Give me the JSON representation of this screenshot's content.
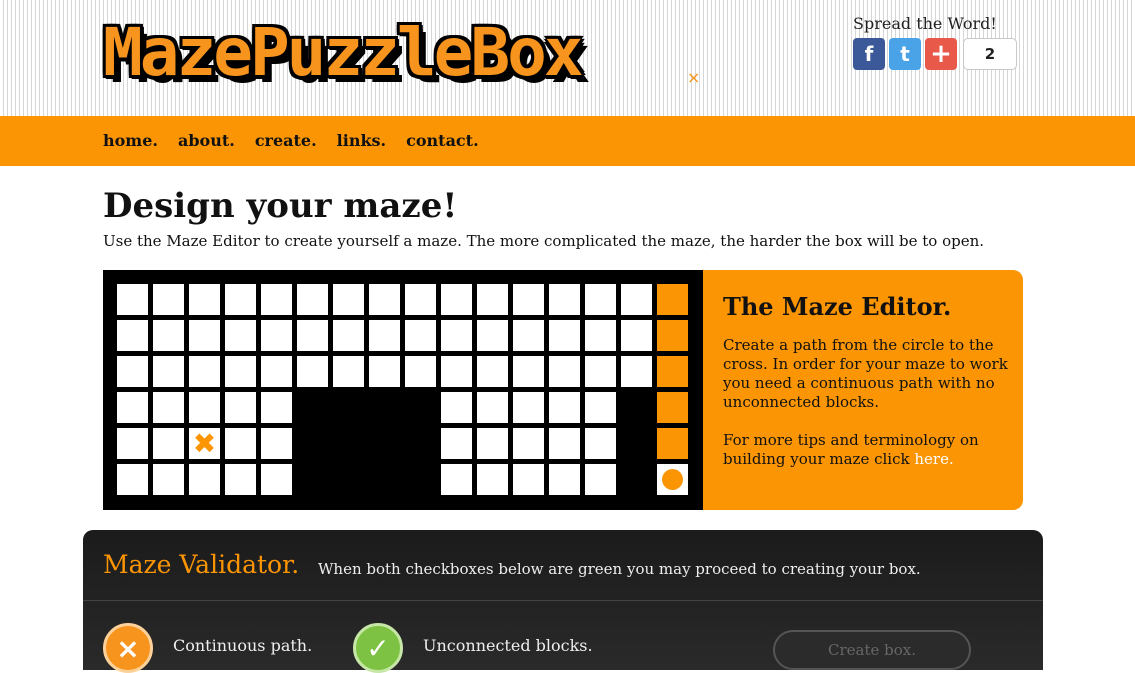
{
  "logo": {
    "text": "MazePuzzleBox",
    "mark": "×"
  },
  "share": {
    "title": "Spread the Word!",
    "facebook_icon": "f",
    "twitter_icon": "t",
    "plus_icon": "+",
    "count": "2"
  },
  "nav": {
    "items": [
      "home.",
      "about.",
      "create.",
      "links.",
      "contact."
    ]
  },
  "page": {
    "title": "Design your maze!",
    "intro": "Use the Maze Editor to create yourself a maze. The more complicated the maze, the harder the box will be to open."
  },
  "maze": {
    "colors": {
      "white": "#ffffff",
      "orange": "#fb9503",
      "black": "#000000"
    },
    "rows": [
      "WWWWWWWWWWWWWWWO",
      "WWWWWWWWWWWWWWWO",
      "WWWWWWWWWWWWWWWO",
      "WWWWW....WWWWW.O",
      "WWXWW....WWWWW.O",
      "WWWWW....WWWWW.C"
    ],
    "start_icon": "circle",
    "finish_icon": "cross"
  },
  "editor": {
    "title": "The Maze Editor.",
    "para1": "Create a path from the circle to the cross. In order for your maze to work you need a continuous path with no unconnected blocks.",
    "para2_prefix": "For more tips and terminology on building your maze click ",
    "link": "here."
  },
  "validator": {
    "title": "Maze Validator.",
    "description": "When both checkboxes below are green you may proceed to creating your box.",
    "checks": [
      {
        "label": "Continuous path.",
        "status": "fail",
        "color": "#f7941d",
        "icon": "×"
      },
      {
        "label": "Unconnected blocks.",
        "status": "pass",
        "color": "#7dc242",
        "icon": "✓"
      }
    ],
    "button": "Create box."
  },
  "colors": {
    "accent": "#fb9503",
    "dark": "#1b1b1b",
    "fail": "#f7941d",
    "pass": "#7dc242"
  }
}
